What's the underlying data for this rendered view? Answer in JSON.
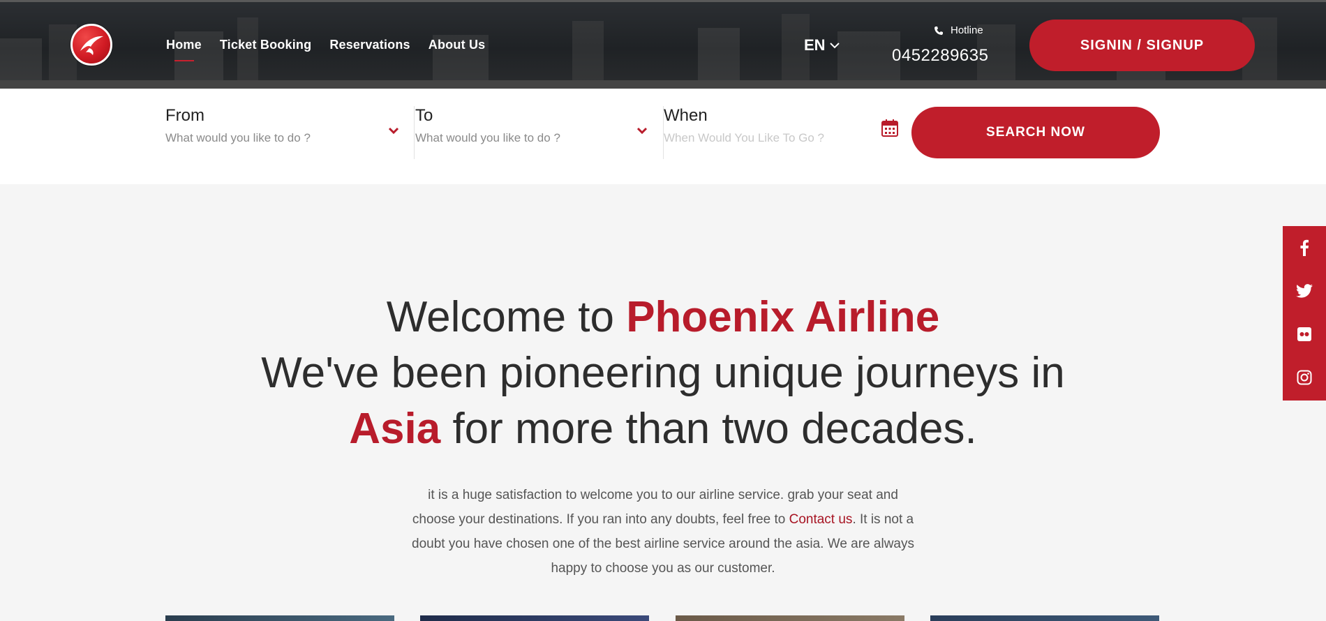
{
  "brand": {
    "logo_icon": "airline-bird-icon",
    "accent": "#c01e2b"
  },
  "nav": {
    "items": [
      {
        "label": "Home",
        "active": true
      },
      {
        "label": "Ticket Booking",
        "active": false
      },
      {
        "label": "Reservations",
        "active": false
      },
      {
        "label": "About Us",
        "active": false
      }
    ]
  },
  "language": {
    "label": "EN",
    "icon": "chevron-down-icon"
  },
  "hotline": {
    "label": "Hotline",
    "number": "0452289635",
    "icon": "phone-icon"
  },
  "signin": {
    "label": "SIGNIN / SIGNUP"
  },
  "search": {
    "from": {
      "label": "From",
      "placeholder": "What would you like to do ?"
    },
    "to": {
      "label": "To",
      "placeholder": "What would you like to do ?"
    },
    "when": {
      "label": "When",
      "placeholder": "When Would You Like To Go ?"
    },
    "button_label": "SEARCH NOW"
  },
  "social": [
    "facebook-icon",
    "twitter-icon",
    "flickr-icon",
    "instagram-icon"
  ],
  "welcome": {
    "line1_prefix": "Welcome to ",
    "line1_highlight": "Phoenix Airline",
    "line2": "We've been pioneering unique journeys in",
    "line3_highlight": "Asia",
    "line3_rest": " for more than two decades."
  },
  "intro": {
    "text_before": "it is a huge satisfaction to welcome you to our airline service. grab your seat and choose your destinations. If you ran into any doubts, feel free to ",
    "link": "Contact us",
    "text_after": ". It is not a doubt you have chosen one of the best airline service around the asia. We are always happy to choose you as our customer."
  }
}
